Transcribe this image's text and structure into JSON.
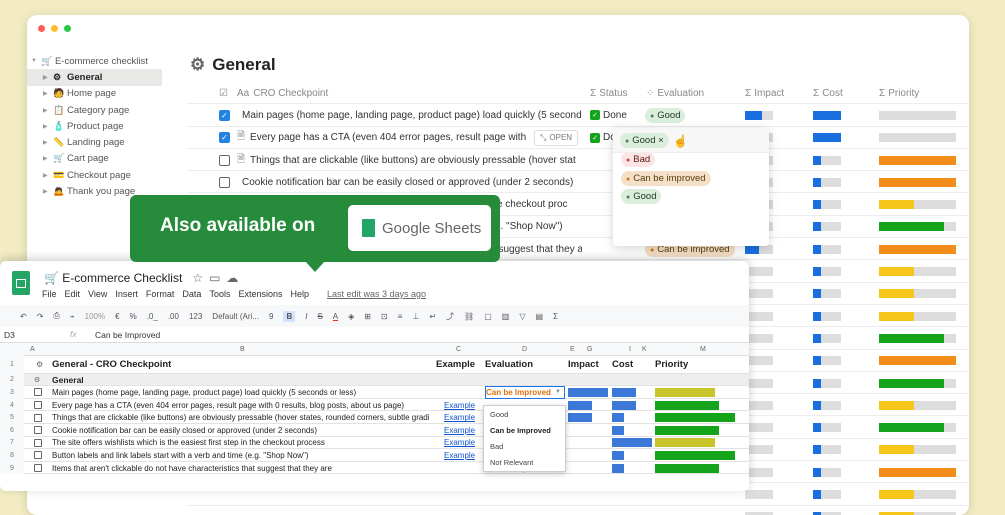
{
  "window_dots": [
    "#ff5f57",
    "#febc2e",
    "#28c840"
  ],
  "sidebar": {
    "root": "E-commerce checklist",
    "items": [
      {
        "label": "General",
        "icon": "gear-icon",
        "active": true
      },
      {
        "label": "Home page",
        "icon": "person-icon"
      },
      {
        "label": "Category page",
        "icon": "clipboard-icon"
      },
      {
        "label": "Product page",
        "icon": "bottle-icon"
      },
      {
        "label": "Landing page",
        "icon": "ruler-icon"
      },
      {
        "label": "Cart page",
        "icon": "cart-icon"
      },
      {
        "label": "Checkout page",
        "icon": "card-icon"
      },
      {
        "label": "Thank you page",
        "icon": "person-bow-icon"
      }
    ]
  },
  "page": {
    "title": "General"
  },
  "columns": {
    "checkpoint": "CRO Checkpoint",
    "status": "Status",
    "evaluation": "Evaluation",
    "impact": "Impact",
    "cost": "Cost",
    "priority": "Priority"
  },
  "rows": [
    {
      "checked": true,
      "text": "Main pages (home page, landing page, product page) load quickly (5 seconds",
      "status": "Done",
      "eval": "Good",
      "impact": 1.0,
      "cost": 1.0,
      "priority": 0.0
    },
    {
      "checked": true,
      "text": "Every page has a CTA (even 404 error pages, result page with",
      "open": "OPEN",
      "status": "Done",
      "eval": "Good",
      "impact": 1.0,
      "cost": 1.0,
      "priority": 0.0
    },
    {
      "checked": false,
      "text": "Things that are clickable (like buttons) are obviously pressable (hover stat",
      "status": "",
      "eval": "",
      "impact": 0.0,
      "cost": 0.3,
      "priority": 1.0
    },
    {
      "checked": false,
      "text": "Cookie notification bar can be easily closed or approved (under 2 seconds)",
      "status": "",
      "eval": "",
      "impact": 0.0,
      "cost": 0.3,
      "priority": 0.0
    },
    {
      "checked": false,
      "text": "The site offers wishlists which is the easiest first step in the checkout proc",
      "status": "",
      "eval": "",
      "impact": 0.0,
      "cost": 0.3,
      "priority": 0.0
    },
    {
      "checked": false,
      "text": "Button labels and link labels start with a verb and time (e.g. \"Shop Now\")",
      "status": "",
      "eval": "",
      "impact": 0.0,
      "cost": 0.3,
      "priority": 0.0
    },
    {
      "checked": false,
      "text": "Items that aren't clickable do not have characteristics that suggest that they a",
      "status": "",
      "eval": "Can be improved",
      "impact": 0.5,
      "cost": 0.3,
      "priority": 0.0
    }
  ],
  "priority_colors": {
    "red": "#e9352c",
    "orange": "#f28c1a",
    "yellow": "#f6c61a",
    "green": "#15a31c"
  },
  "notion_priority_bars": [
    [
      "gray",
      0.0
    ],
    [
      "gray",
      0.0
    ],
    [
      "orange",
      1.0
    ],
    [
      "orange",
      1.0
    ],
    [
      "yellow",
      0.45
    ],
    [
      "green",
      0.85
    ],
    [
      "orange",
      1.0
    ],
    [
      "yellow",
      0.45
    ],
    [
      "yellow",
      0.45
    ],
    [
      "yellow",
      0.45
    ],
    [
      "green",
      0.85
    ],
    [
      "orange",
      1.0
    ],
    [
      "green",
      0.85
    ],
    [
      "yellow",
      0.45
    ],
    [
      "green",
      0.85
    ],
    [
      "yellow",
      0.45
    ],
    [
      "orange",
      1.0
    ],
    [
      "yellow",
      0.45
    ],
    [
      "yellow",
      0.45
    ]
  ],
  "notion_impact_bars": [
    0.6,
    0.6,
    0,
    0,
    0,
    0,
    0.5,
    0,
    0,
    0,
    0,
    0,
    0,
    0,
    0,
    0,
    0,
    0,
    0
  ],
  "notion_cost_bars": [
    1.0,
    1.0,
    0.3,
    0.3,
    0.3,
    0.3,
    0.3,
    0.3,
    0.3,
    0.3,
    0.3,
    0.3,
    0.3,
    0.3,
    0.3,
    0.3,
    0.3,
    0.3,
    0.3
  ],
  "dropdown": {
    "current": "Good",
    "options": [
      "Not relevant",
      "Bad",
      "Can be improved",
      "Good"
    ]
  },
  "banner": {
    "text": "Also available on",
    "product": "Google Sheets"
  },
  "sheet": {
    "title": "E-commerce Checklist",
    "menu": [
      "File",
      "Edit",
      "View",
      "Insert",
      "Format",
      "Data",
      "Tools",
      "Extensions",
      "Help"
    ],
    "last_edit": "Last edit was 3 days ago",
    "toolbar": {
      "zoom": "100%",
      "currency": "€",
      "percent": "%",
      "dec1": ".0_",
      "dec2": ".00",
      "fmt": "123",
      "font": "Default (Ari...",
      "size": "9"
    },
    "cell_ref": "D3",
    "fx_value": "Can be Improved",
    "col_letters": [
      "A",
      "B",
      "C",
      "D",
      "E",
      "G",
      "I",
      "K",
      "M"
    ],
    "header": {
      "title": "General - CRO Checkpoint",
      "example": "Example",
      "evaluation": "Evaluation",
      "impact": "Impact",
      "cost": "Cost",
      "priority": "Priority"
    },
    "section": "General",
    "rows": [
      {
        "n": "3",
        "text": "Main pages (home page, landing page, product page) load quickly (5 seconds or less)",
        "example": "",
        "eval": "Can be Improved",
        "impact": 1.0,
        "cost": 0.6,
        "pcolor": "#c9c42a",
        "p": 0.75
      },
      {
        "n": "4",
        "text": "Every page has a CTA (even 404 error pages, result page with 0 results, blog posts, about us page)",
        "example": "Example",
        "eval": "",
        "impact": 0.6,
        "cost": 0.6,
        "pcolor": "#15a31c",
        "p": 0.8
      },
      {
        "n": "5",
        "text": "Things that are clickable (like buttons) are obviously pressable (hover states, rounded corners, subtle gradi",
        "example": "Example",
        "eval": "",
        "impact": 0.6,
        "cost": 0.3,
        "pcolor": "#15a31c",
        "p": 1.0
      },
      {
        "n": "6",
        "text": "Cookie notification bar can be easily closed or approved (under 2 seconds)",
        "example": "Example",
        "eval": "",
        "impact": 0.0,
        "cost": 0.3,
        "pcolor": "#15a31c",
        "p": 0.8
      },
      {
        "n": "7",
        "text": "The site offers wishlists which is the easiest first step in the checkout process",
        "example": "Example",
        "eval": "",
        "impact": 0.0,
        "cost": 1.0,
        "pcolor": "#c9c42a",
        "p": 0.75
      },
      {
        "n": "8",
        "text": "Button labels and link labels start with a verb and time (e.g. \"Shop Now\")",
        "example": "Example",
        "eval": "",
        "impact": 0.0,
        "cost": 0.3,
        "pcolor": "#15a31c",
        "p": 1.0
      },
      {
        "n": "9",
        "text": "Items that aren't clickable do not have characteristics that suggest that they are",
        "example": "",
        "eval": "Can be Improved",
        "impact": 0.0,
        "cost": 0.3,
        "pcolor": "#15a31c",
        "p": 0.8
      }
    ],
    "dropdown_options": [
      "Good",
      "Can be Improved",
      "Bad",
      "Not Relevant"
    ]
  }
}
